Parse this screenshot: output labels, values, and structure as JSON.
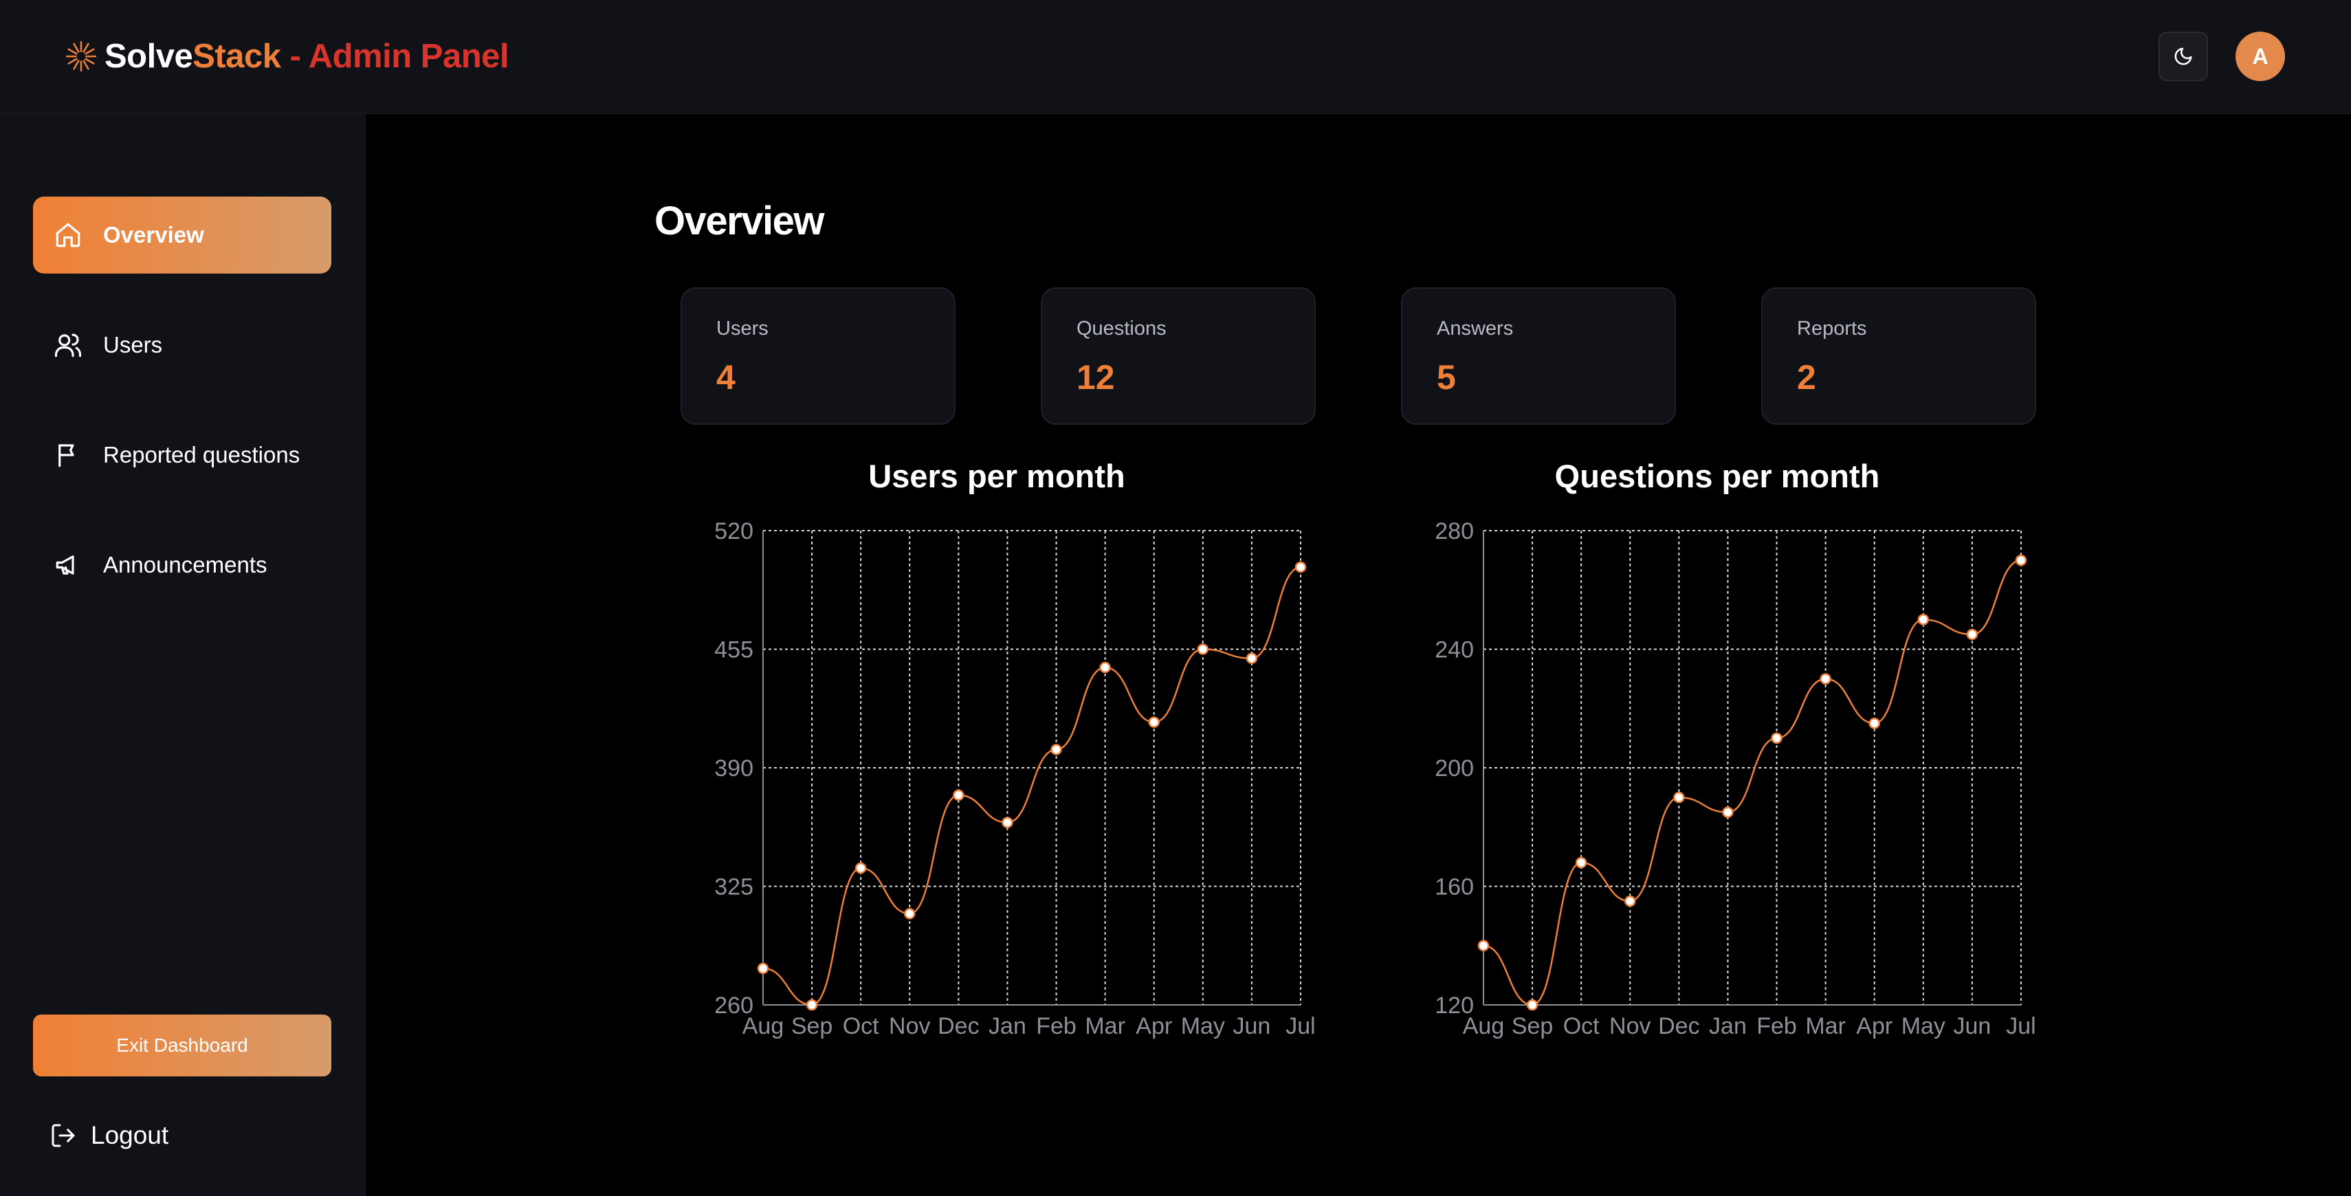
{
  "brand": {
    "name_part1": "Solve",
    "name_part2": "Stack",
    "suffix": " - Admin Panel"
  },
  "header": {
    "theme_icon": "moon-icon",
    "avatar_initial": "A"
  },
  "sidebar": {
    "items": [
      {
        "label": "Overview",
        "icon": "home-icon",
        "active": true
      },
      {
        "label": "Users",
        "icon": "users-icon"
      },
      {
        "label": "Reported questions",
        "icon": "flag-icon"
      },
      {
        "label": "Announcements",
        "icon": "megaphone-icon"
      }
    ],
    "exit_label": "Exit Dashboard",
    "logout_label": "Logout"
  },
  "main": {
    "title": "Overview",
    "stats": [
      {
        "label": "Users",
        "value": "4"
      },
      {
        "label": "Questions",
        "value": "12"
      },
      {
        "label": "Answers",
        "value": "5"
      },
      {
        "label": "Reports",
        "value": "2"
      }
    ]
  },
  "colors": {
    "accent": "#ee7f38",
    "admin_red": "#d9342b",
    "panel": "#111217",
    "background": "#000000"
  },
  "chart_data": [
    {
      "type": "line",
      "title": "Users per month",
      "categories": [
        "Aug",
        "Sep",
        "Oct",
        "Nov",
        "Dec",
        "Jan",
        "Feb",
        "Mar",
        "Apr",
        "May",
        "Jun",
        "Jul"
      ],
      "values": [
        280,
        260,
        335,
        310,
        375,
        360,
        400,
        445,
        415,
        455,
        450,
        500
      ],
      "ylim": [
        260,
        520
      ],
      "yticks": [
        "520",
        "455",
        "390",
        "325",
        "260"
      ],
      "grid": true
    },
    {
      "type": "line",
      "title": "Questions per month",
      "categories": [
        "Aug",
        "Sep",
        "Oct",
        "Nov",
        "Dec",
        "Jan",
        "Feb",
        "Mar",
        "Apr",
        "May",
        "Jun",
        "Jul"
      ],
      "values": [
        140,
        120,
        168,
        155,
        190,
        185,
        210,
        230,
        215,
        250,
        245,
        270
      ],
      "ylim": [
        120,
        280
      ],
      "yticks": [
        "280",
        "240",
        "200",
        "160",
        "120"
      ],
      "grid": true
    }
  ]
}
